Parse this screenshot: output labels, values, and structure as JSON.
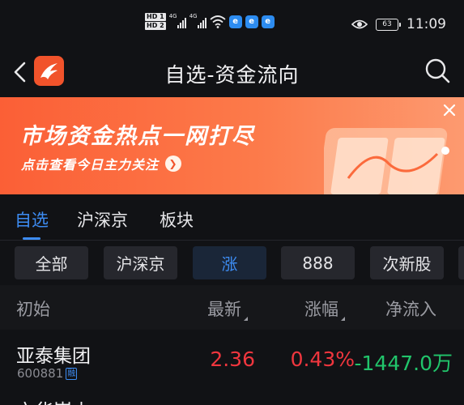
{
  "status_bar": {
    "hd1": "HD 1",
    "hd2": "HD 2",
    "net1": "4G",
    "net2": "4G",
    "app_badge": "e",
    "battery": "63",
    "time": "11:09"
  },
  "header": {
    "title": "自选-资金流向"
  },
  "banner": {
    "headline": "市场资金热点一网打尽",
    "subline": "点击查看今日主力关注"
  },
  "tabs": [
    {
      "label": "自选",
      "active": true
    },
    {
      "label": "沪深京",
      "active": false
    },
    {
      "label": "板块",
      "active": false
    }
  ],
  "filters": [
    {
      "label": "全部",
      "active": false
    },
    {
      "label": "沪深京",
      "active": false
    },
    {
      "label": "涨",
      "active": true
    },
    {
      "label": "888",
      "active": false
    },
    {
      "label": "次新股",
      "active": false
    }
  ],
  "table": {
    "columns": [
      "初始",
      "最新",
      "涨幅",
      "净流入"
    ],
    "rows": [
      {
        "name": "亚泰集团",
        "code": "600881",
        "badge": "融",
        "latest": "2.36",
        "change": "0.43%",
        "net_inflow": "-1447.0万"
      }
    ],
    "next_row_partial": "六华嵩山"
  },
  "colors": {
    "accent": "#3d8cf2",
    "up": "#f0363e",
    "down": "#21c56b",
    "banner": "#fb5f36",
    "background": "#111215"
  }
}
